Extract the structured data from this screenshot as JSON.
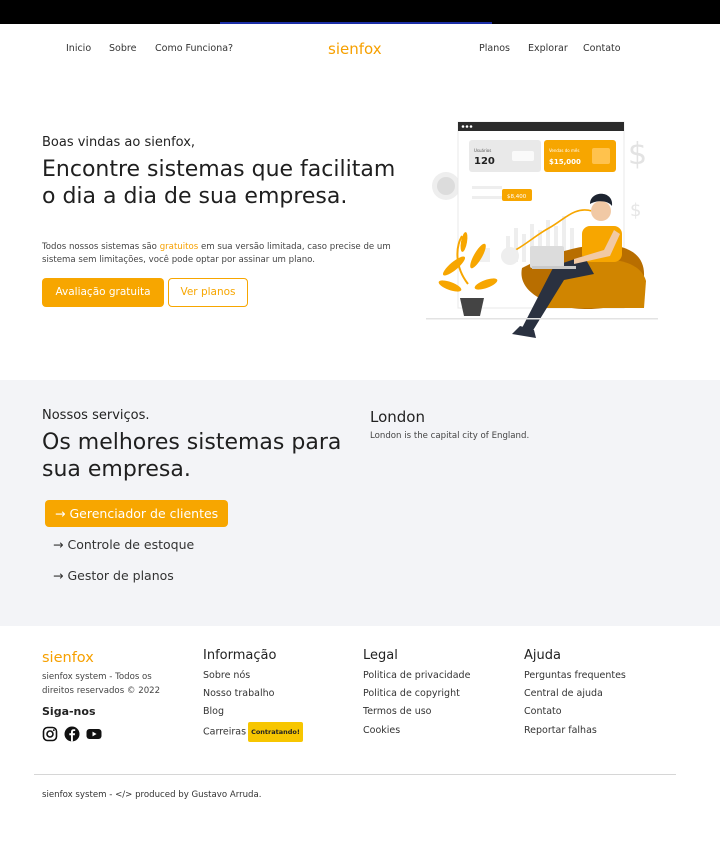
{
  "nav": {
    "left": [
      "Inicio",
      "Sobre",
      "Como Funciona?"
    ],
    "brand": "sienfox",
    "right": [
      "Planos",
      "Explorar",
      "Contato"
    ]
  },
  "hero": {
    "welcome": "Boas vindas ao sienfox,",
    "headline": "Encontre sistemas que facilitam o dia a dia de sua empresa.",
    "desc_before": "Todos nossos sistemas são ",
    "desc_highlight": "gratuitos",
    "desc_after": " em sua versão limitada, caso precise de um sistema sem limitações, você pode optar por assinar um plano.",
    "cta_primary": "Avaliação gratuita",
    "cta_secondary": "Ver planos",
    "illustration": {
      "card1_label": "Usuários",
      "card1_value": "120",
      "card2_label": "Vendas do mês",
      "card2_value": "$15,000",
      "chart_tag": "$8,400"
    }
  },
  "services": {
    "label": "Nossos serviços.",
    "title": "Os melhores sistemas para sua empresa.",
    "items": [
      "Gerenciador de clientes",
      "Controle de estoque",
      "Gestor de planos"
    ],
    "arrow": "→",
    "detail_title": "London",
    "detail_text": "London is the capital city of England."
  },
  "footer": {
    "brand": "sienfox",
    "rights": "sienfox system - Todos os direitos reservados © 2022",
    "follow": "Siga-nos",
    "columns": [
      {
        "title": "Informação",
        "links": [
          "Sobre nós",
          "Nosso trabalho",
          "Blog",
          "Carreiras"
        ]
      },
      {
        "title": "Legal",
        "links": [
          "Politica de privacidade",
          "Politica de copyright",
          "Termos de uso",
          "Cookies"
        ]
      },
      {
        "title": "Ajuda",
        "links": [
          "Perguntas frequentes",
          "Central de ajuda",
          "Contato",
          "Reportar falhas"
        ]
      }
    ],
    "careers_badge": "Contratando!",
    "credit": "sienfox system - </> produced by Gustavo Arruda."
  },
  "colors": {
    "accent": "#f7a600",
    "services_bg": "#f3f4f7",
    "text": "#1f1f1f"
  },
  "icons": [
    "instagram-icon",
    "facebook-icon",
    "youtube-icon",
    "arrow-right-icon"
  ]
}
